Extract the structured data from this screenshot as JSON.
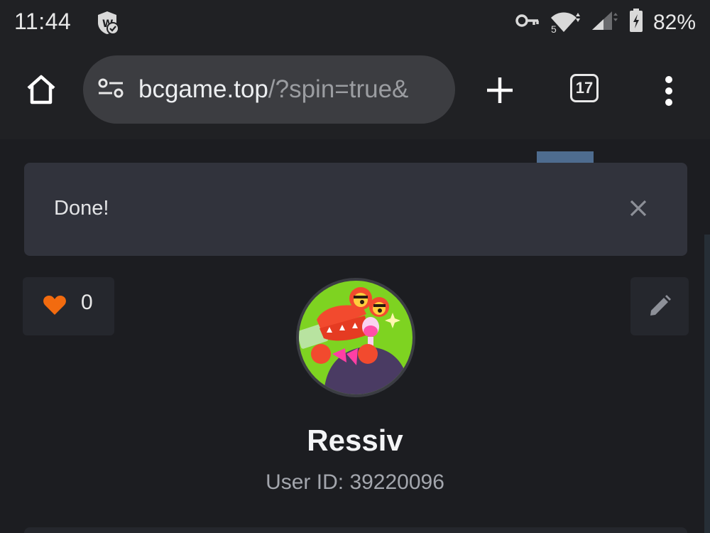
{
  "status_bar": {
    "time": "11:44",
    "app_icon": "shield-check-icon",
    "key_icon": "key-icon",
    "wifi_icon": "wifi-icon",
    "wifi_label": "5",
    "signal_icon": "cell-signal-icon",
    "battery_icon": "battery-charging-icon",
    "battery_percent": "82%"
  },
  "toolbar": {
    "home_icon": "home-icon",
    "url_icon": "tune-icon",
    "url_host": "bcgame.top",
    "url_path": "/?spin=true&",
    "new_tab_icon": "plus-icon",
    "tab_count": "17",
    "menu_icon": "more-vert-icon"
  },
  "toast": {
    "message": "Done!",
    "close_icon": "close-icon"
  },
  "profile": {
    "like_icon": "heart-icon",
    "like_count": "0",
    "edit_icon": "pencil-icon",
    "username": "Ressiv",
    "user_id_label": "User ID:",
    "user_id": "39220096"
  },
  "colors": {
    "background": "#1c1d21",
    "toolbar": "#202124",
    "toast": "#31333c",
    "heart": "#f26b0f",
    "avatar_ring": "#3b3d43",
    "avatar_bg": "#7ed321"
  }
}
